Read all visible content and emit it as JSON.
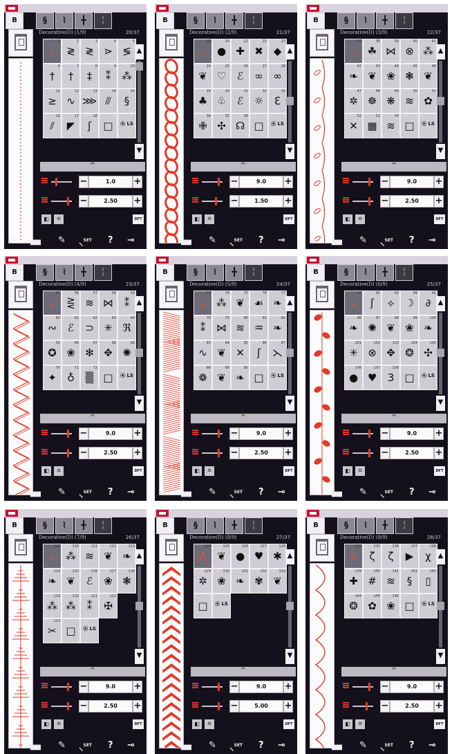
{
  "header": {
    "tab_needle": "B",
    "tab_glyphs": [
      "§",
      "⌇",
      "╋",
      "╏"
    ]
  },
  "nav": {
    "home": "⌂",
    "embroidery": "▄▖",
    "file": "✎",
    "settings": "SET",
    "help": "?",
    "key": "⊸"
  },
  "controls": {
    "collapse_glyph": "^",
    "minus": "−",
    "plus": "+",
    "dft_label": "DFT"
  },
  "colors": {
    "accent": "#e03a2a",
    "panel": "#15111c"
  },
  "screens": [
    {
      "title": "Decorative(D) (1/9)",
      "count": "20/37",
      "width": "1.0",
      "length": "2.50",
      "cells": [
        {
          "n": "1",
          "g": "⌄",
          "sel": true
        },
        {
          "n": "2",
          "g": "≷"
        },
        {
          "n": "3",
          "g": "≷"
        },
        {
          "n": "4",
          "g": "⋗"
        },
        {
          "n": "5",
          "g": "≶"
        },
        {
          "n": "6",
          "g": "†"
        },
        {
          "n": "7",
          "g": "†"
        },
        {
          "n": "8",
          "g": "‡"
        },
        {
          "n": "9",
          "g": "⁑"
        },
        {
          "n": "10",
          "g": "⁂"
        },
        {
          "n": "11",
          "g": "≥"
        },
        {
          "n": "12",
          "g": "∿"
        },
        {
          "n": "13",
          "g": "⋙"
        },
        {
          "n": "14",
          "g": "⫻"
        },
        {
          "n": "15",
          "g": "§"
        },
        {
          "n": "16",
          "g": "⫽"
        },
        {
          "n": "17",
          "g": "◤"
        },
        {
          "n": "18",
          "g": "ʃ"
        },
        {
          "n": "",
          "g": "□"
        },
        {
          "n": "",
          "g": "⦿ LS",
          "ls": true
        }
      ]
    },
    {
      "title": "Decorative(D) (2/9)",
      "count": "21/37",
      "width": "9.0",
      "length": "1.50",
      "cells": [
        {
          "n": "19",
          "g": "⌄",
          "sel": true
        },
        {
          "n": "20",
          "g": "●"
        },
        {
          "n": "21",
          "g": "✚"
        },
        {
          "n": "22",
          "g": "✖"
        },
        {
          "n": "23",
          "g": "◆"
        },
        {
          "n": "24",
          "g": "❦"
        },
        {
          "n": "25",
          "g": "♡"
        },
        {
          "n": "26",
          "g": "ℰ"
        },
        {
          "n": "27",
          "g": "∞"
        },
        {
          "n": "28",
          "g": "∞"
        },
        {
          "n": "29",
          "g": "♣"
        },
        {
          "n": "30",
          "g": "♧"
        },
        {
          "n": "31",
          "g": "ℰ"
        },
        {
          "n": "32",
          "g": "☼"
        },
        {
          "n": "33",
          "g": "ℇ"
        },
        {
          "n": "34",
          "g": "✙"
        },
        {
          "n": "35",
          "g": "✣"
        },
        {
          "n": "36",
          "g": "☊"
        },
        {
          "n": "",
          "g": "□"
        },
        {
          "n": "",
          "g": "⦿ LS",
          "ls": true
        }
      ]
    },
    {
      "title": "Decorative(D) (3/9)",
      "count": "22/37",
      "width": "9.0",
      "length": "2.50",
      "cells": [
        {
          "n": "37",
          "g": "⌄",
          "sel": true
        },
        {
          "n": "38",
          "g": "☘"
        },
        {
          "n": "39",
          "g": "⋈"
        },
        {
          "n": "40",
          "g": "⊗"
        },
        {
          "n": "41",
          "g": "⁂"
        },
        {
          "n": "42",
          "g": "❧"
        },
        {
          "n": "43",
          "g": "❦"
        },
        {
          "n": "44",
          "g": "❀"
        },
        {
          "n": "45",
          "g": "❃"
        },
        {
          "n": "46",
          "g": "❦"
        },
        {
          "n": "47",
          "g": "✲"
        },
        {
          "n": "48",
          "g": "☸"
        },
        {
          "n": "49",
          "g": "❋"
        },
        {
          "n": "50",
          "g": "≋"
        },
        {
          "n": "51",
          "g": "✿"
        },
        {
          "n": "52",
          "g": "✕"
        },
        {
          "n": "53",
          "g": "▦"
        },
        {
          "n": "54",
          "g": "≋"
        },
        {
          "n": "",
          "g": "□"
        },
        {
          "n": "",
          "g": "⦿ LS",
          "ls": true
        }
      ]
    },
    {
      "title": "Decorative(D) (4/9)",
      "count": "23/37",
      "width": "9.0",
      "length": "2.50",
      "cells": [
        {
          "n": "55",
          "g": "⌄",
          "sel": true
        },
        {
          "n": "56",
          "g": "⋛"
        },
        {
          "n": "57",
          "g": "≋"
        },
        {
          "n": "58",
          "g": "⋈"
        },
        {
          "n": "59",
          "g": "⁑"
        },
        {
          "n": "60",
          "g": "∾"
        },
        {
          "n": "61",
          "g": "ℰ"
        },
        {
          "n": "62",
          "g": "⊃"
        },
        {
          "n": "63",
          "g": "✳"
        },
        {
          "n": "64",
          "g": "ℜ"
        },
        {
          "n": "65",
          "g": "✪"
        },
        {
          "n": "66",
          "g": "❀"
        },
        {
          "n": "67",
          "g": "✻"
        },
        {
          "n": "68",
          "g": "✥"
        },
        {
          "n": "69",
          "g": "✺"
        },
        {
          "n": "70",
          "g": "✦"
        },
        {
          "n": "71",
          "g": "♁"
        },
        {
          "n": "72",
          "g": "▒"
        },
        {
          "n": "",
          "g": "□"
        },
        {
          "n": "",
          "g": "⦿ LS",
          "ls": true
        }
      ]
    },
    {
      "title": "Decorative(D) (5/9)",
      "count": "24/37",
      "width": "9.0",
      "length": "2.50",
      "cells": [
        {
          "n": "73",
          "g": "⌄",
          "sel": true
        },
        {
          "n": "74",
          "g": "⁂"
        },
        {
          "n": "75",
          "g": "❦"
        },
        {
          "n": "76",
          "g": "☙"
        },
        {
          "n": "77",
          "g": "❧"
        },
        {
          "n": "78",
          "g": "⁑"
        },
        {
          "n": "79",
          "g": "⋈"
        },
        {
          "n": "80",
          "g": "≋"
        },
        {
          "n": "81",
          "g": "♒"
        },
        {
          "n": "82",
          "g": "❧"
        },
        {
          "n": "83",
          "g": "∿"
        },
        {
          "n": "84",
          "g": "❦"
        },
        {
          "n": "85",
          "g": "✕"
        },
        {
          "n": "86",
          "g": "ʃ"
        },
        {
          "n": "87",
          "g": "⋋"
        },
        {
          "n": "88",
          "g": "❁"
        },
        {
          "n": "89",
          "g": "❦"
        },
        {
          "n": "90",
          "g": "❧"
        },
        {
          "n": "",
          "g": "□"
        },
        {
          "n": "",
          "g": "⦿ LS",
          "ls": true
        }
      ]
    },
    {
      "title": "Decorative(D) (6/9)",
      "count": "25/37",
      "width": "9.0",
      "length": "2.50",
      "cells": [
        {
          "n": "91",
          "g": "⌄",
          "sel": true
        },
        {
          "n": "92",
          "g": "ʃ"
        },
        {
          "n": "93",
          "g": "⟡"
        },
        {
          "n": "94",
          "g": "☽"
        },
        {
          "n": "95",
          "g": "∂"
        },
        {
          "n": "96",
          "g": "❧"
        },
        {
          "n": "97",
          "g": "✺"
        },
        {
          "n": "98",
          "g": "❦"
        },
        {
          "n": "99",
          "g": "❀"
        },
        {
          "n": "100",
          "g": "❧"
        },
        {
          "n": "101",
          "g": "✳"
        },
        {
          "n": "102",
          "g": "⊗"
        },
        {
          "n": "103",
          "g": "✥"
        },
        {
          "n": "104",
          "g": "❂"
        },
        {
          "n": "105",
          "g": "✣"
        },
        {
          "n": "106",
          "g": "●"
        },
        {
          "n": "107",
          "g": "♥"
        },
        {
          "n": "108",
          "g": "3"
        },
        {
          "n": "",
          "g": "□"
        },
        {
          "n": "",
          "g": "⦿ LS",
          "ls": true
        }
      ]
    },
    {
      "title": "Decorative(D) (7/9)",
      "count": "26/37",
      "width": "9.0",
      "length": "2.50",
      "cells": [
        {
          "n": "109",
          "g": "⌄",
          "sel": true
        },
        {
          "n": "110",
          "g": "⁂"
        },
        {
          "n": "111",
          "g": "≋"
        },
        {
          "n": "112",
          "g": "❦"
        },
        {
          "n": "113",
          "g": "❧"
        },
        {
          "n": "114",
          "g": "❧"
        },
        {
          "n": "115",
          "g": "❦"
        },
        {
          "n": "116",
          "g": "ℰ"
        },
        {
          "n": "117",
          "g": "❀"
        },
        {
          "n": "118",
          "g": "❃"
        },
        {
          "n": "119",
          "g": "⁂"
        },
        {
          "n": "120",
          "g": "⁂"
        },
        {
          "n": "121",
          "g": "⁑"
        },
        {
          "n": "122",
          "g": "✠"
        },
        {
          "n": "",
          "g": ""
        },
        {
          "n": "123",
          "g": "✂"
        },
        {
          "n": "",
          "g": "□"
        },
        {
          "n": "",
          "g": "⦿ LS",
          "ls": true
        }
      ]
    },
    {
      "title": "Decorative(D) (8/9)",
      "count": "27/37",
      "width": "9.0",
      "length": "5.00",
      "cells": [
        {
          "n": "124",
          "g": "⋀",
          "sel": true
        },
        {
          "n": "125",
          "g": "❦"
        },
        {
          "n": "126",
          "g": "●"
        },
        {
          "n": "127",
          "g": "♥"
        },
        {
          "n": "128",
          "g": "✱"
        },
        {
          "n": "129",
          "g": "✲"
        },
        {
          "n": "130",
          "g": "❀"
        },
        {
          "n": "131",
          "g": "❧"
        },
        {
          "n": "132",
          "g": "✾"
        },
        {
          "n": "133",
          "g": "❦"
        },
        {
          "n": "",
          "g": "□"
        },
        {
          "n": "",
          "g": "⦿ LS",
          "ls": true
        }
      ]
    },
    {
      "title": "Decorative(D) (9/9)",
      "count": "28/37",
      "width": "9.0",
      "length": "2.50",
      "cells": [
        {
          "n": "134",
          "g": "∿",
          "sel": true
        },
        {
          "n": "135",
          "g": "ζ"
        },
        {
          "n": "136",
          "g": "ζ"
        },
        {
          "n": "137",
          "g": "▶"
        },
        {
          "n": "138",
          "g": "χ"
        },
        {
          "n": "139",
          "g": "✚"
        },
        {
          "n": "140",
          "g": "#"
        },
        {
          "n": "141",
          "g": "≋"
        },
        {
          "n": "142",
          "g": "§"
        },
        {
          "n": "143",
          "g": "▯"
        },
        {
          "n": "144",
          "g": "❂"
        },
        {
          "n": "145",
          "g": "✿"
        },
        {
          "n": "146",
          "g": "❀"
        },
        {
          "n": "",
          "g": "□"
        },
        {
          "n": "",
          "g": "⦿ LS",
          "ls": true
        }
      ]
    }
  ]
}
